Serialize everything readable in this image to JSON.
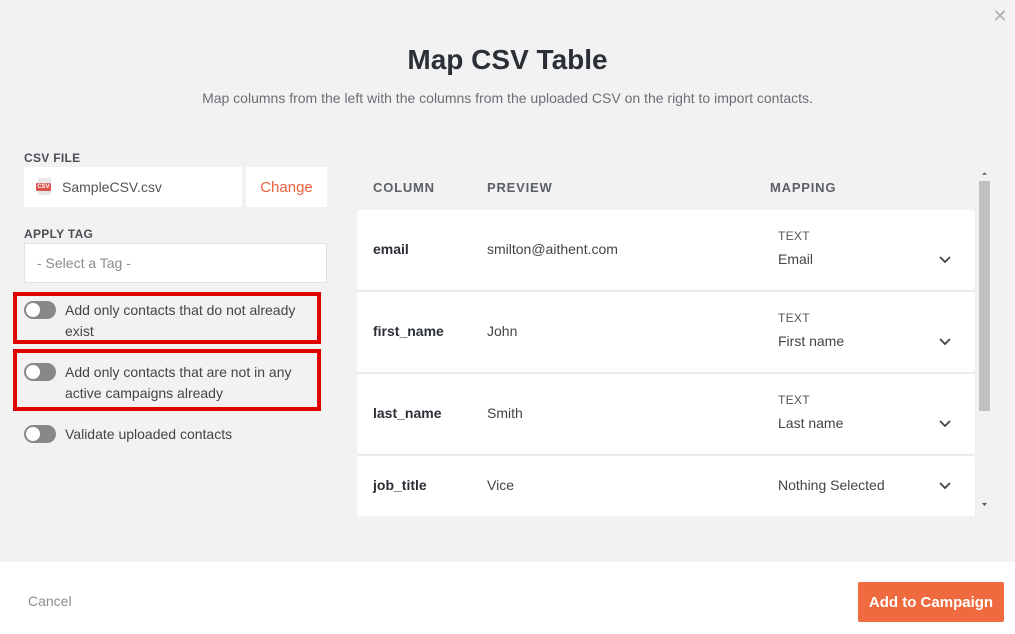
{
  "modal": {
    "title": "Map CSV Table",
    "subtitle": "Map columns from the left with the columns from the uploaded CSV on the right to import contacts."
  },
  "csv_file": {
    "label": "CSV FILE",
    "file_name": "SampleCSV.csv",
    "icon_text": "CSV",
    "change_label": "Change"
  },
  "apply_tag": {
    "label": "APPLY TAG",
    "placeholder": "- Select a Tag -"
  },
  "options": [
    {
      "label": "Add only contacts that do not already exist",
      "enabled": false
    },
    {
      "label": "Add only contacts that are not in any active campaigns already",
      "enabled": false
    },
    {
      "label": "Validate uploaded contacts",
      "enabled": false
    }
  ],
  "table": {
    "headers": {
      "column": "COLUMN",
      "preview": "PREVIEW",
      "mapping": "MAPPING"
    },
    "rows": [
      {
        "column": "email",
        "preview": "smilton@aithent.com",
        "mapping_type": "TEXT",
        "mapping_value": "Email"
      },
      {
        "column": "first_name",
        "preview": "John",
        "mapping_type": "TEXT",
        "mapping_value": "First name"
      },
      {
        "column": "last_name",
        "preview": "Smith",
        "mapping_type": "TEXT",
        "mapping_value": "Last name"
      },
      {
        "column": "job_title",
        "preview": "Vice",
        "mapping_type": "",
        "mapping_value": "Nothing Selected"
      }
    ]
  },
  "footer": {
    "cancel_label": "Cancel",
    "submit_label": "Add to Campaign"
  },
  "colors": {
    "accent": "#ef6a3f",
    "highlight": "#e00000"
  }
}
